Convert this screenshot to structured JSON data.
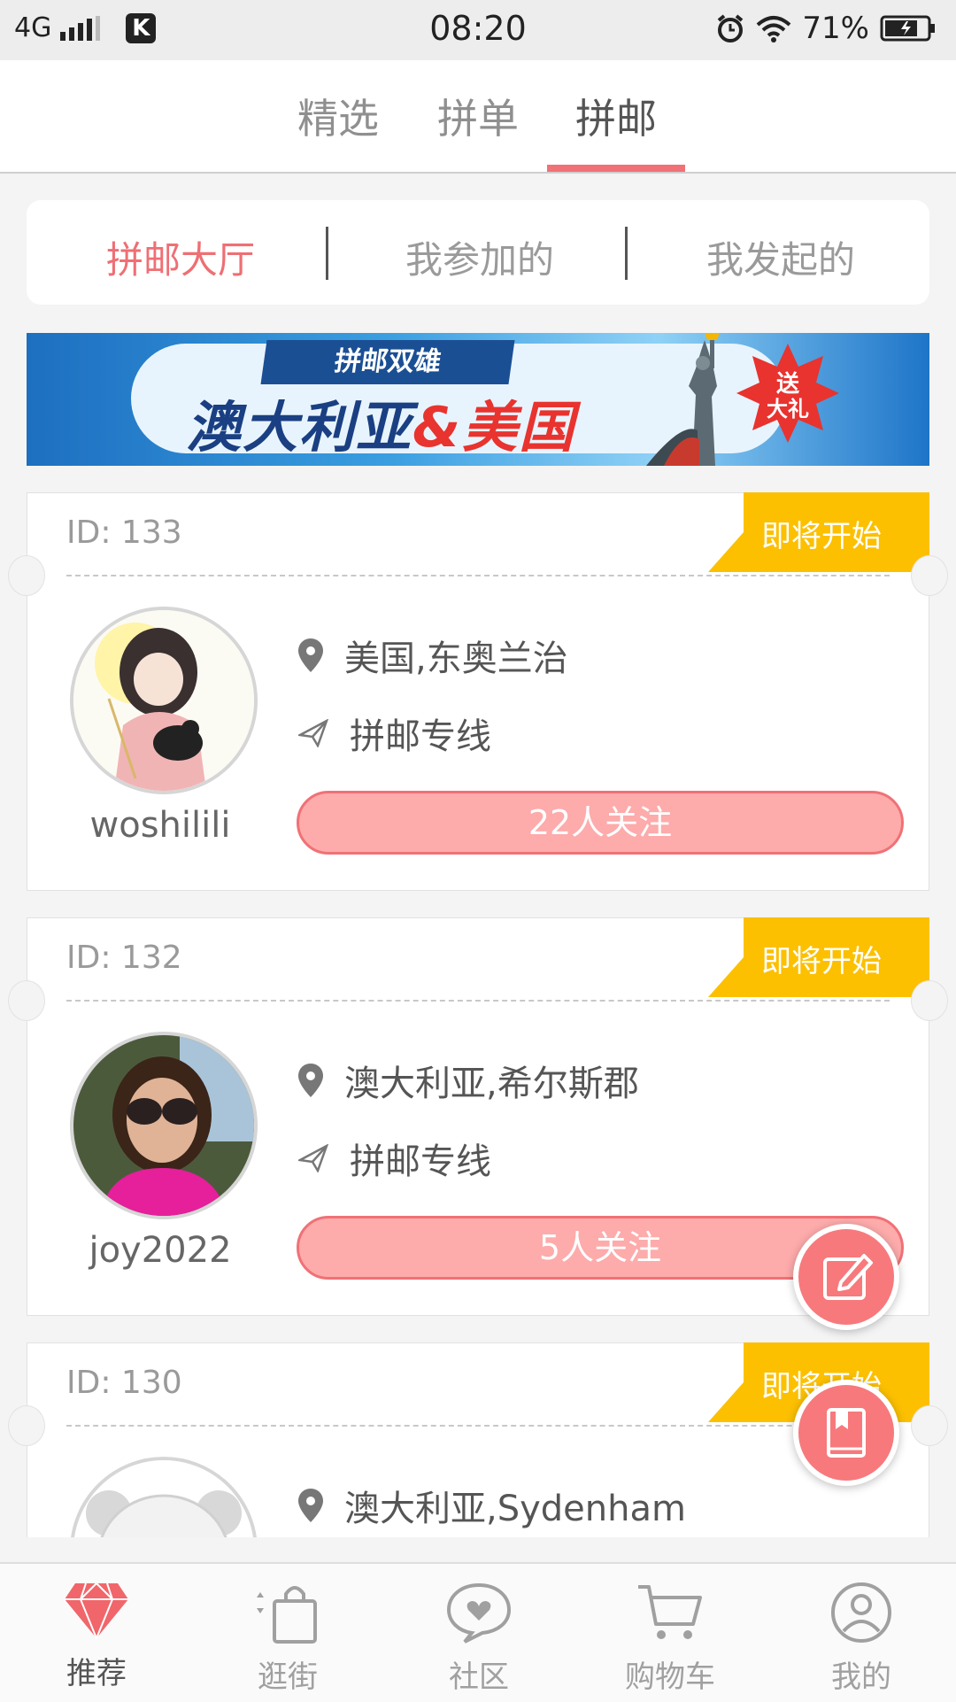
{
  "status_bar": {
    "network": "4G",
    "time": "08:20",
    "battery": "71%"
  },
  "top_tabs": [
    {
      "label": "精选"
    },
    {
      "label": "拼单"
    },
    {
      "label": "拼邮"
    }
  ],
  "segments": [
    {
      "label": "拼邮大厅"
    },
    {
      "label": "我参加的"
    },
    {
      "label": "我发起的"
    }
  ],
  "banner": {
    "tag": "拼邮双雄",
    "title_a": "澳大利亚",
    "title_amp": "&",
    "title_b": "美国",
    "burst": "送大礼"
  },
  "cards": [
    {
      "id": "ID: 133",
      "status": "即将开始",
      "username": "woshilili",
      "location": "美国,东奥兰治",
      "line": "拼邮专线",
      "follow": "22人关注"
    },
    {
      "id": "ID: 132",
      "status": "即将开始",
      "username": "joy2022",
      "location": "澳大利亚,希尔斯郡",
      "line": "拼邮专线",
      "follow": "5人关注"
    },
    {
      "id": "ID: 130",
      "status": "即将开始",
      "username": "",
      "location": "澳大利亚,Sydenham",
      "line": "",
      "follow": ""
    }
  ],
  "bottom_nav": [
    {
      "label": "推荐"
    },
    {
      "label": "逛街"
    },
    {
      "label": "社区"
    },
    {
      "label": "购物车"
    },
    {
      "label": "我的"
    }
  ],
  "colors": {
    "accent": "#f07176",
    "badge": "#fcc000",
    "follow_fill": "#fdabab"
  }
}
